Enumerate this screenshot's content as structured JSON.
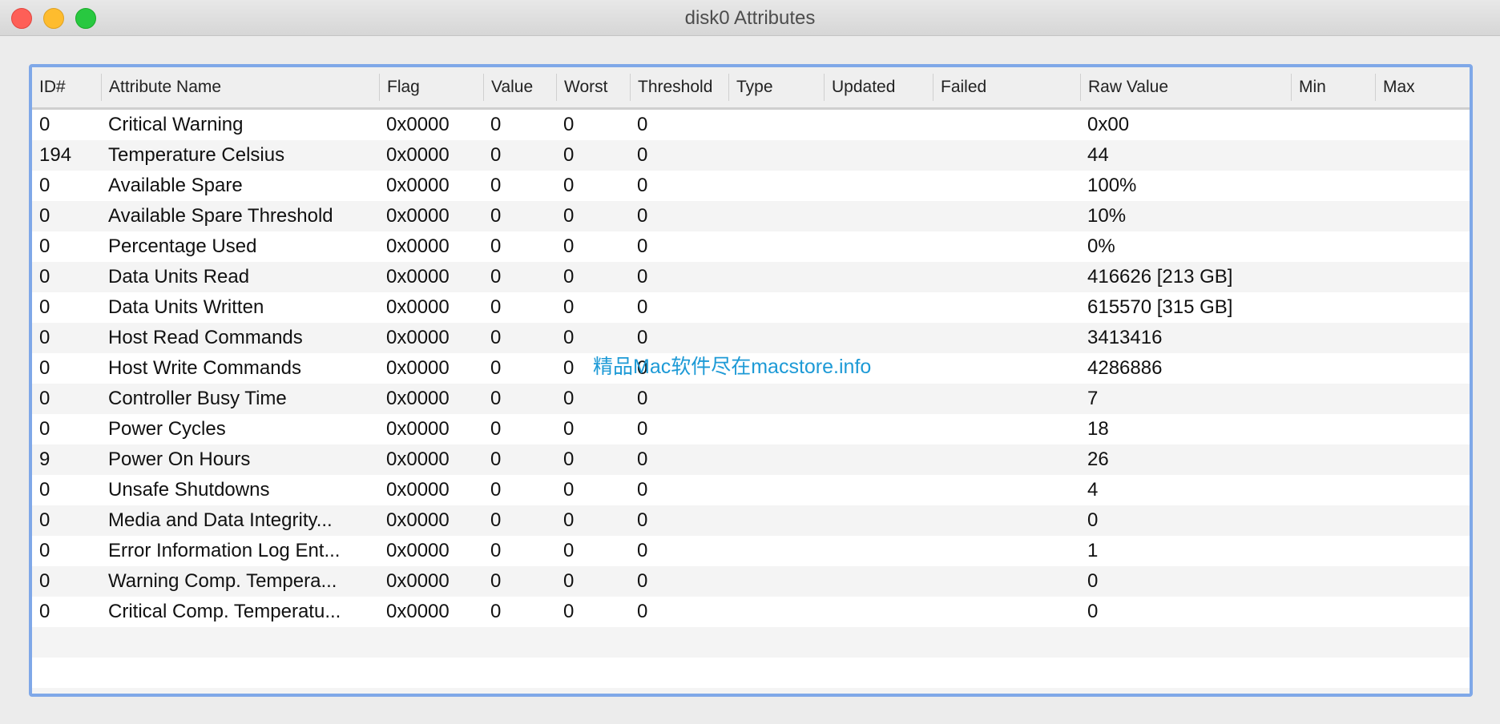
{
  "window": {
    "title": "disk0 Attributes"
  },
  "table": {
    "columns": [
      "ID#",
      "Attribute Name",
      "Flag",
      "Value",
      "Worst",
      "Threshold",
      "Type",
      "Updated",
      "Failed",
      "Raw Value",
      "Min",
      "Max"
    ],
    "rows": [
      [
        "0",
        "Critical Warning",
        "0x0000",
        "0",
        "0",
        "0",
        "",
        "",
        "",
        "0x00",
        "",
        ""
      ],
      [
        "194",
        "Temperature Celsius",
        "0x0000",
        "0",
        "0",
        "0",
        "",
        "",
        "",
        "44",
        "",
        ""
      ],
      [
        "0",
        "Available Spare",
        "0x0000",
        "0",
        "0",
        "0",
        "",
        "",
        "",
        "100%",
        "",
        ""
      ],
      [
        "0",
        "Available Spare Threshold",
        "0x0000",
        "0",
        "0",
        "0",
        "",
        "",
        "",
        "10%",
        "",
        ""
      ],
      [
        "0",
        "Percentage Used",
        "0x0000",
        "0",
        "0",
        "0",
        "",
        "",
        "",
        "0%",
        "",
        ""
      ],
      [
        "0",
        "Data Units Read",
        "0x0000",
        "0",
        "0",
        "0",
        "",
        "",
        "",
        "416626 [213 GB]",
        "",
        ""
      ],
      [
        "0",
        "Data Units Written",
        "0x0000",
        "0",
        "0",
        "0",
        "",
        "",
        "",
        "615570 [315 GB]",
        "",
        ""
      ],
      [
        "0",
        "Host Read Commands",
        "0x0000",
        "0",
        "0",
        "0",
        "",
        "",
        "",
        "3413416",
        "",
        ""
      ],
      [
        "0",
        "Host Write Commands",
        "0x0000",
        "0",
        "0",
        "0",
        "",
        "",
        "",
        "4286886",
        "",
        ""
      ],
      [
        "0",
        "Controller Busy Time",
        "0x0000",
        "0",
        "0",
        "0",
        "",
        "",
        "",
        "7",
        "",
        ""
      ],
      [
        "0",
        "Power Cycles",
        "0x0000",
        "0",
        "0",
        "0",
        "",
        "",
        "",
        "18",
        "",
        ""
      ],
      [
        "9",
        "Power On Hours",
        "0x0000",
        "0",
        "0",
        "0",
        "",
        "",
        "",
        "26",
        "",
        ""
      ],
      [
        "0",
        "Unsafe Shutdowns",
        "0x0000",
        "0",
        "0",
        "0",
        "",
        "",
        "",
        "4",
        "",
        ""
      ],
      [
        "0",
        "Media and Data Integrity...",
        "0x0000",
        "0",
        "0",
        "0",
        "",
        "",
        "",
        "0",
        "",
        ""
      ],
      [
        "0",
        "Error Information Log Ent...",
        "0x0000",
        "0",
        "0",
        "0",
        "",
        "",
        "",
        "1",
        "",
        ""
      ],
      [
        "0",
        "Warning  Comp. Tempera...",
        "0x0000",
        "0",
        "0",
        "0",
        "",
        "",
        "",
        "0",
        "",
        ""
      ],
      [
        "0",
        "Critical Comp. Temperatu...",
        "0x0000",
        "0",
        "0",
        "0",
        "",
        "",
        "",
        "0",
        "",
        ""
      ]
    ]
  },
  "watermark": "精品Mac软件尽在macstore.info",
  "colors": {
    "close": "#fe5f57",
    "minimize": "#febc2e",
    "zoom": "#28c840",
    "focus_ring": "#7fa8e8",
    "watermark": "#1d9ad6"
  }
}
